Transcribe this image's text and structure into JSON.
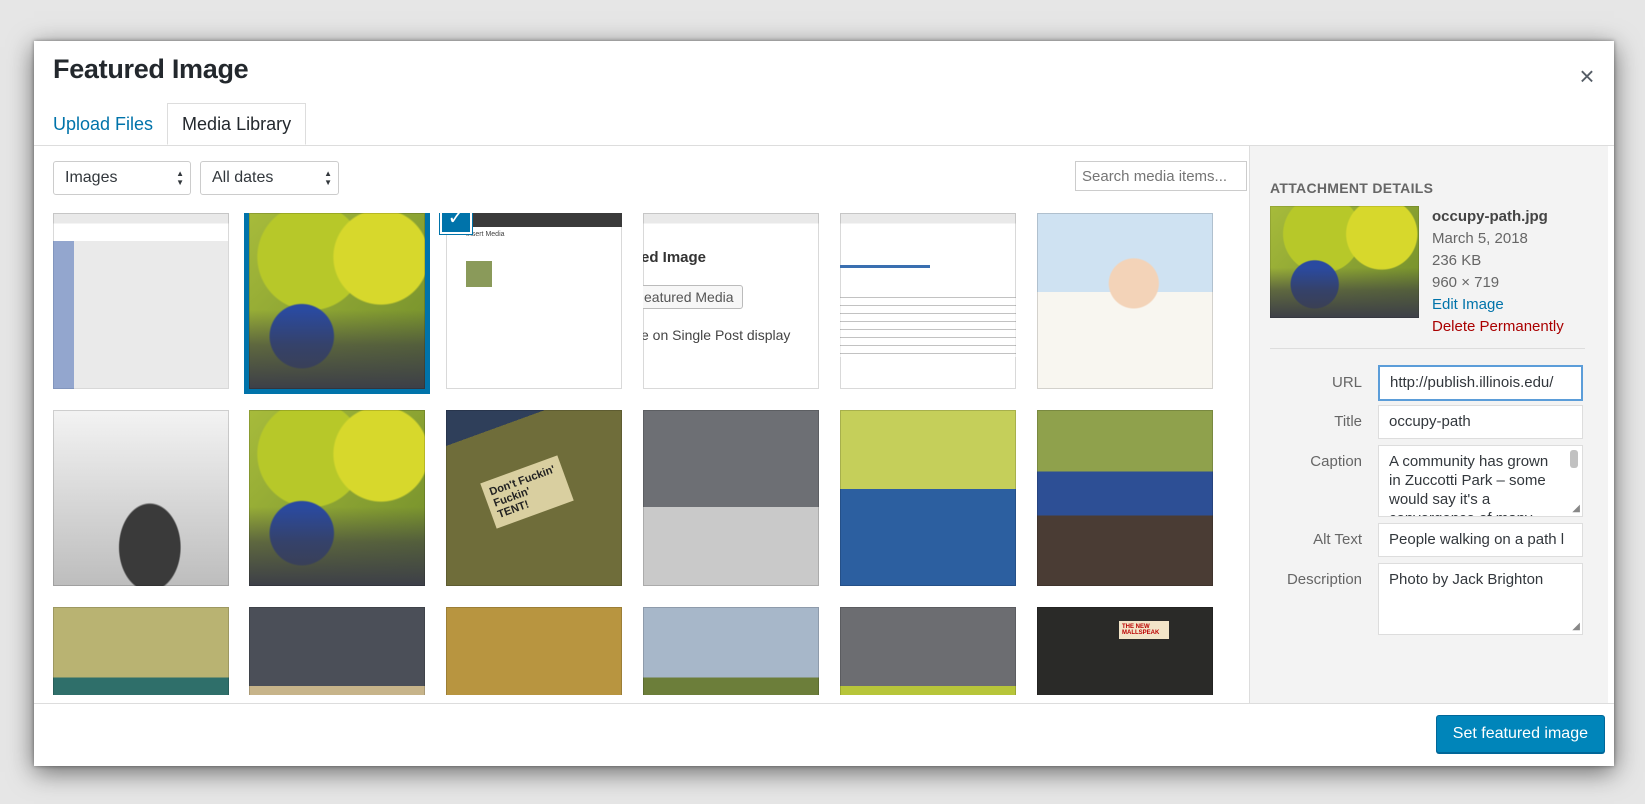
{
  "modal": {
    "title": "Featured Image",
    "close_label": "×"
  },
  "tabs": [
    {
      "label": "Upload Files"
    },
    {
      "label": "Media Library"
    }
  ],
  "filters": {
    "type_value": "Images",
    "date_value": "All dates",
    "search_placeholder": "Search media items..."
  },
  "thumbnails": {
    "screenshot_2_text": "Insert Media",
    "screenshot_3_title": "ed Image",
    "screenshot_3_button": "eatured Media",
    "screenshot_3_line": "e on Single Post display",
    "tent_sign_text": "Don't Fuckin' Fuckin' TENT!",
    "book_text": "THE NEW MALLSPEAK"
  },
  "details": {
    "heading": "ATTACHMENT DETAILS",
    "filename": "occupy-path.jpg",
    "date": "March 5, 2018",
    "size": "236 KB",
    "dimensions": "960 × 719",
    "edit_link": "Edit Image",
    "delete_link": "Delete Permanently",
    "fields": {
      "url_label": "URL",
      "url_value": "http://publish.illinois.edu/",
      "title_label": "Title",
      "title_value": "occupy-path",
      "caption_label": "Caption",
      "caption_value": "A community has grown in Zuccotti Park – some would say it's a convergence of many",
      "alt_label": "Alt Text",
      "alt_value": "People walking on a path l",
      "description_label": "Description",
      "description_value": "Photo by Jack Brighton"
    }
  },
  "footer": {
    "primary_label": "Set featured image"
  },
  "colors": {
    "accent": "#0073aa",
    "primary_button": "#0085ba",
    "danger": "#aa0000"
  }
}
